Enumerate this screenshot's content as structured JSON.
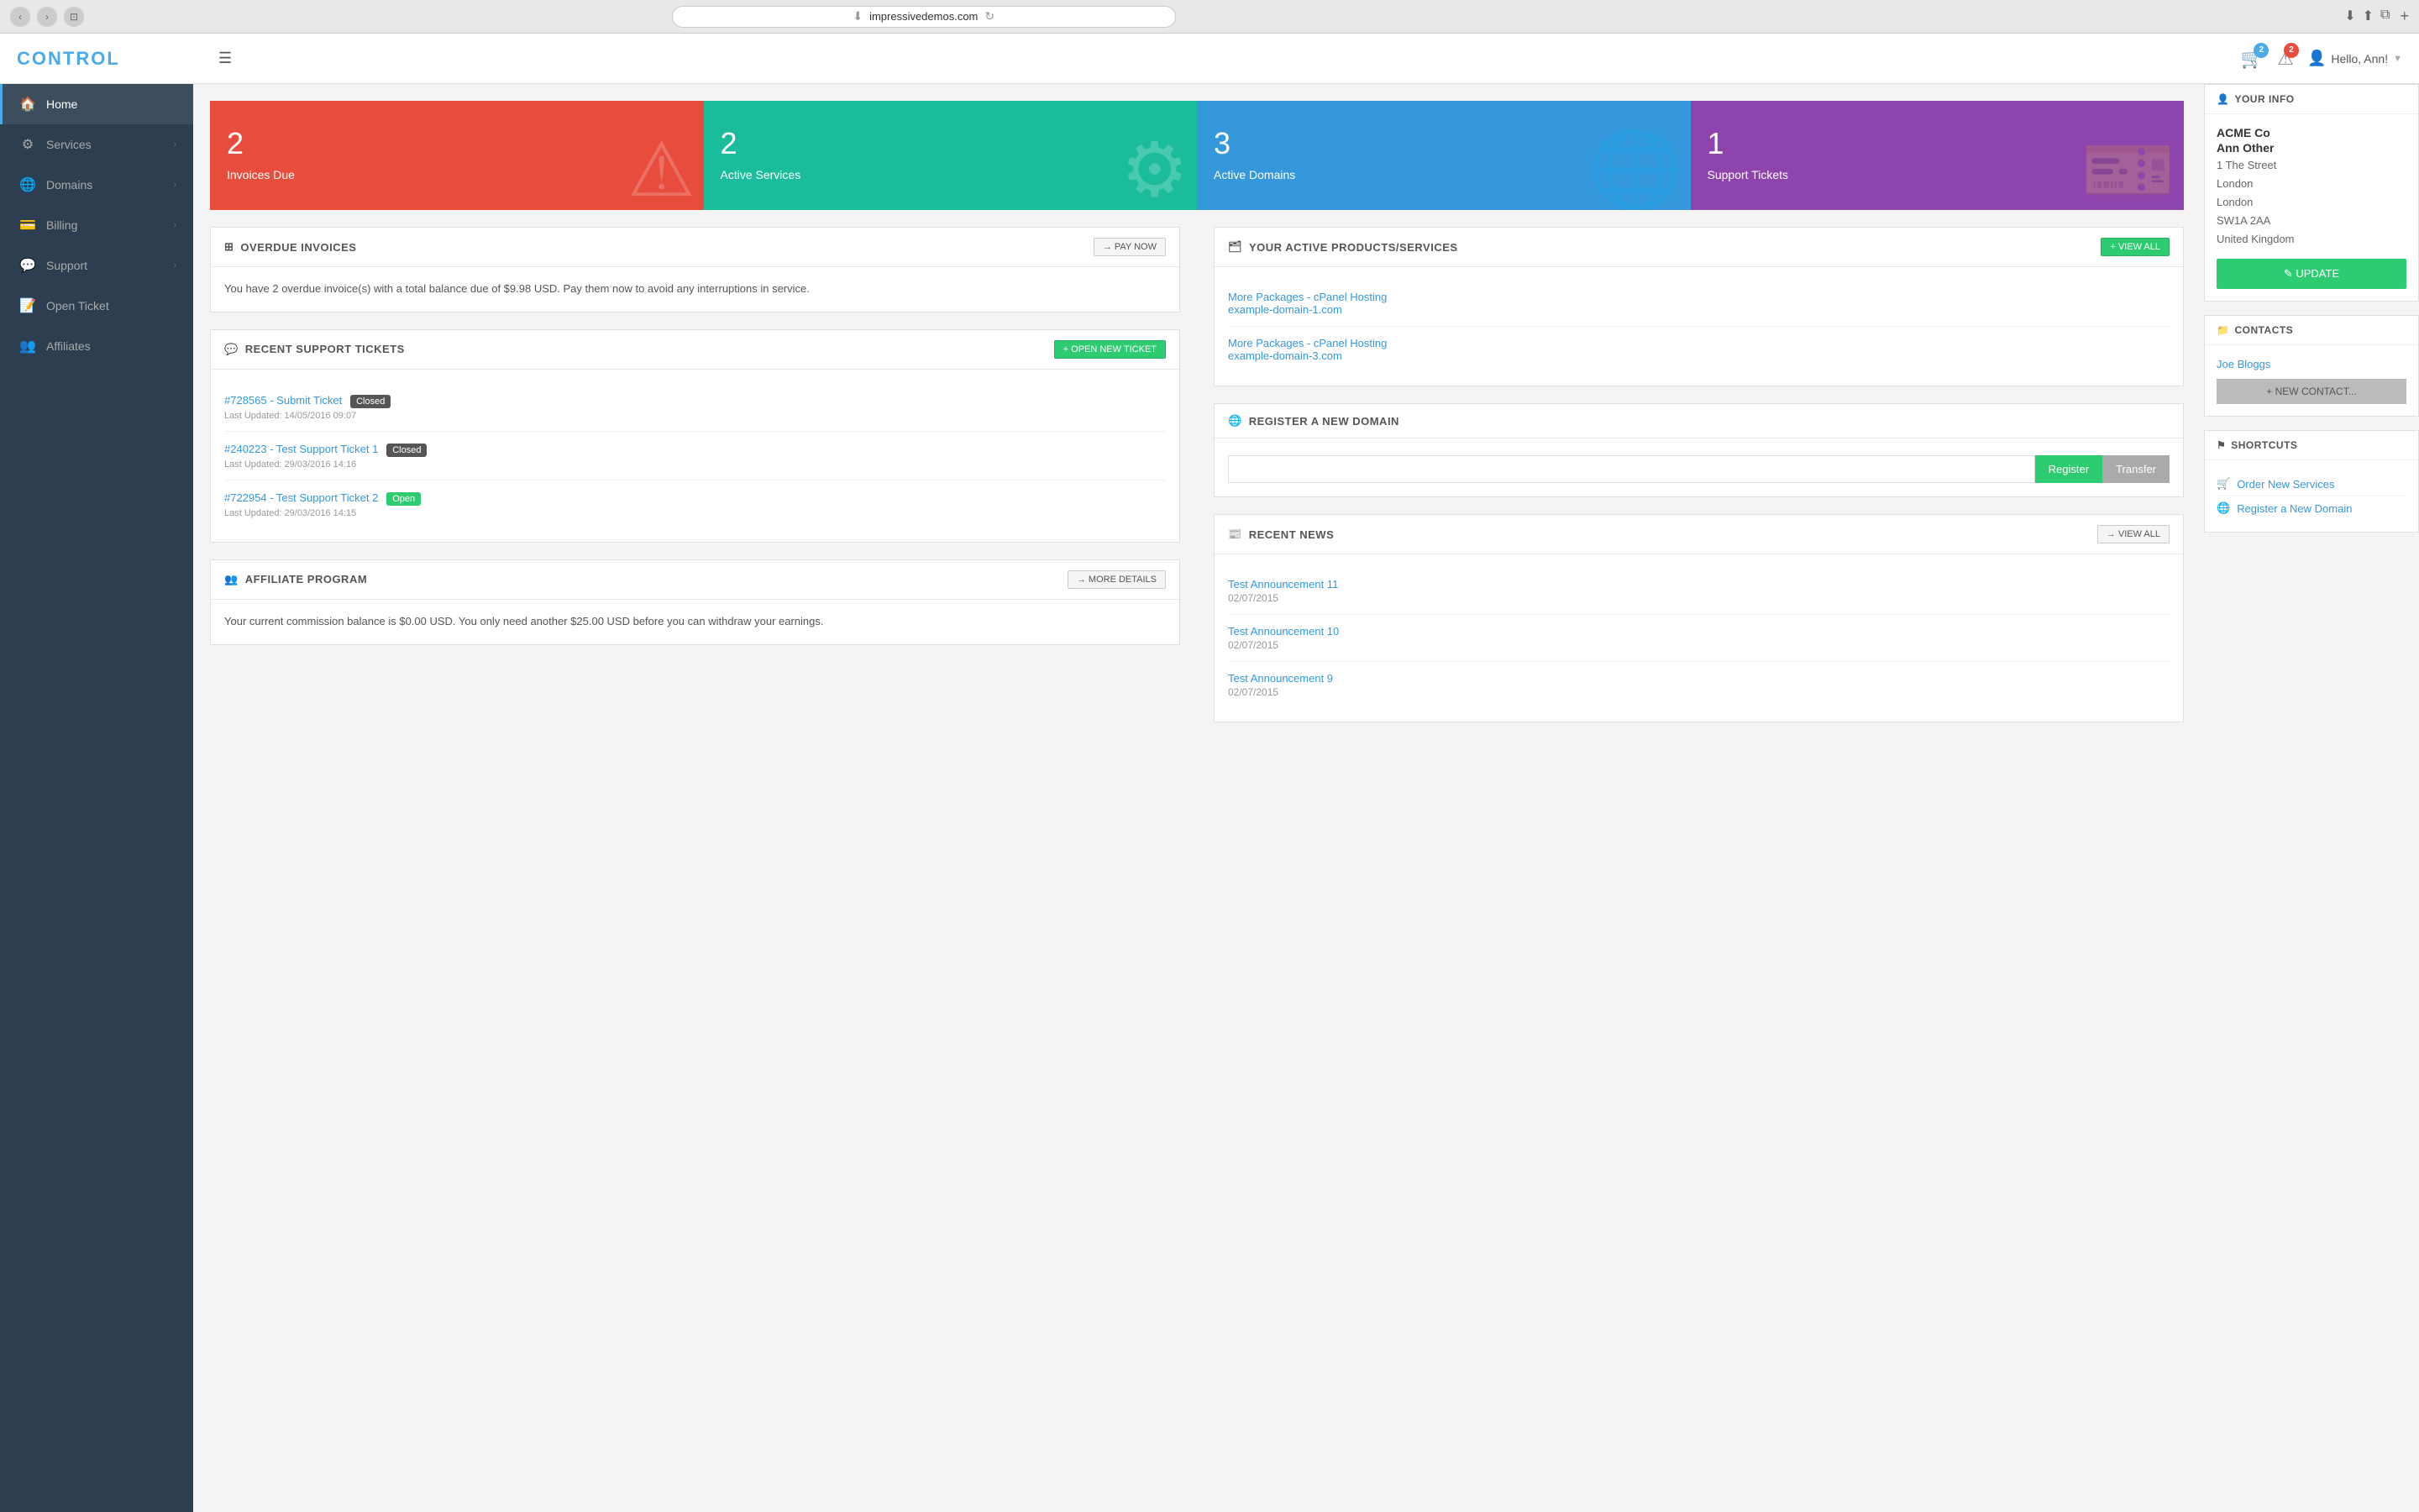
{
  "browser": {
    "url": "impressivedemos.com",
    "reload_title": "Reload"
  },
  "header": {
    "logo": "CONTROL",
    "hamburger": "☰",
    "cart_badge": "2",
    "alert_badge": "2",
    "user_greeting": "Hello, Ann!",
    "cart_icon": "🛒",
    "alert_icon": "⚠"
  },
  "sidebar": {
    "items": [
      {
        "id": "home",
        "icon": "🏠",
        "label": "Home",
        "active": true,
        "has_chevron": false
      },
      {
        "id": "services",
        "icon": "⚙",
        "label": "Services",
        "active": false,
        "has_chevron": true
      },
      {
        "id": "domains",
        "icon": "🌐",
        "label": "Domains",
        "active": false,
        "has_chevron": true
      },
      {
        "id": "billing",
        "icon": "💳",
        "label": "Billing",
        "active": false,
        "has_chevron": true
      },
      {
        "id": "support",
        "icon": "💬",
        "label": "Support",
        "active": false,
        "has_chevron": true
      },
      {
        "id": "open-ticket",
        "icon": "📝",
        "label": "Open Ticket",
        "active": false,
        "has_chevron": false
      },
      {
        "id": "affiliates",
        "icon": "👥",
        "label": "Affiliates",
        "active": false,
        "has_chevron": false
      }
    ]
  },
  "stats": [
    {
      "id": "invoices-due",
      "number": "2",
      "label": "Invoices Due",
      "color": "red",
      "icon": "⚠"
    },
    {
      "id": "active-services",
      "number": "2",
      "label": "Active Services",
      "color": "teal",
      "icon": "⚙"
    },
    {
      "id": "active-domains",
      "number": "3",
      "label": "Active Domains",
      "color": "blue",
      "icon": "🌐"
    },
    {
      "id": "support-tickets",
      "number": "1",
      "label": "Support Tickets",
      "color": "purple",
      "icon": "🎫"
    }
  ],
  "overdue_invoices": {
    "title": "OVERDUE INVOICES",
    "pay_now_label": "→ PAY NOW",
    "text": "You have 2 overdue invoice(s) with a total balance due of $9.98 USD. Pay them now to avoid any interruptions in service."
  },
  "support_tickets": {
    "title": "RECENT SUPPORT TICKETS",
    "open_new_label": "+ OPEN NEW TICKET",
    "items": [
      {
        "id": "ticket-1",
        "link_text": "#728565 - Submit Ticket",
        "status": "Closed",
        "status_type": "closed",
        "date": "Last Updated: 14/05/2016 09:07"
      },
      {
        "id": "ticket-2",
        "link_text": "#240223 - Test Support Ticket 1",
        "status": "Closed",
        "status_type": "closed",
        "date": "Last Updated: 29/03/2016 14:16"
      },
      {
        "id": "ticket-3",
        "link_text": "#722954 - Test Support Ticket 2",
        "status": "Open",
        "status_type": "open",
        "date": "Last Updated: 29/03/2016 14:15"
      }
    ]
  },
  "affiliate": {
    "title": "AFFILIATE PROGRAM",
    "more_details_label": "→ MORE DETAILS",
    "text": "Your current commission balance is $0.00 USD. You only need another $25.00 USD before you can withdraw your earnings."
  },
  "active_products": {
    "title": "YOUR ACTIVE PRODUCTS/SERVICES",
    "view_all_label": "+ VIEW ALL",
    "items": [
      {
        "id": "service-1",
        "line1": "More Packages - cPanel Hosting",
        "line2": "example-domain-1.com"
      },
      {
        "id": "service-2",
        "line1": "More Packages - cPanel Hosting",
        "line2": "example-domain-3.com"
      }
    ]
  },
  "register_domain": {
    "title": "REGISTER A NEW DOMAIN",
    "placeholder": "",
    "register_label": "Register",
    "transfer_label": "Transfer"
  },
  "recent_news": {
    "title": "RECENT NEWS",
    "view_all_label": "→ VIEW ALL",
    "items": [
      {
        "id": "news-1",
        "title": "Test Announcement 11",
        "date": "02/07/2015"
      },
      {
        "id": "news-2",
        "title": "Test Announcement 10",
        "date": "02/07/2015"
      },
      {
        "id": "news-3",
        "title": "Test Announcement 9",
        "date": "02/07/2015"
      }
    ]
  },
  "your_info": {
    "section_title": "YOUR INFO",
    "company": "ACME Co",
    "name": "Ann Other",
    "address_line1": "1 The Street",
    "address_line2": "London",
    "address_line3": "London",
    "address_line4": "SW1A 2AA",
    "address_line5": "United Kingdom",
    "update_label": "✎ UPDATE"
  },
  "contacts": {
    "section_title": "CONTACTS",
    "contact_name": "Joe Bloggs",
    "new_contact_label": "+ NEW CONTACT..."
  },
  "shortcuts": {
    "section_title": "SHORTCUTS",
    "items": [
      {
        "id": "shortcut-order",
        "icon": "🛒",
        "label": "Order New Services"
      },
      {
        "id": "shortcut-domain",
        "icon": "🌐",
        "label": "Register a New Domain"
      }
    ]
  }
}
